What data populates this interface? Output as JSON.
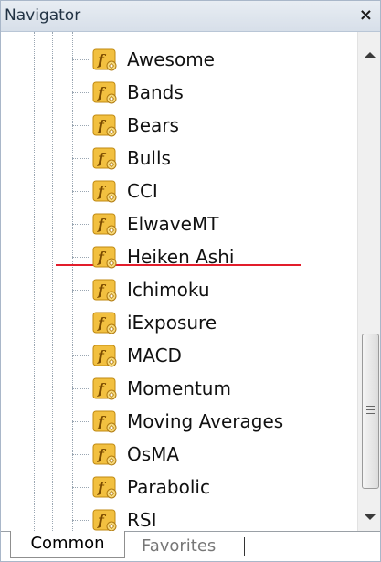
{
  "window": {
    "title": "Navigator",
    "close_label": "×"
  },
  "tree": {
    "icon": "indicator-f-icon",
    "items": [
      {
        "label": "Awesome"
      },
      {
        "label": "Bands"
      },
      {
        "label": "Bears"
      },
      {
        "label": "Bulls"
      },
      {
        "label": "CCI"
      },
      {
        "label": "ElwaveMT",
        "highlighted": true
      },
      {
        "label": "Heiken Ashi"
      },
      {
        "label": "Ichimoku"
      },
      {
        "label": "iExposure"
      },
      {
        "label": "MACD"
      },
      {
        "label": "Momentum"
      },
      {
        "label": "Moving Averages"
      },
      {
        "label": "OsMA"
      },
      {
        "label": "Parabolic"
      },
      {
        "label": "RSI"
      }
    ]
  },
  "tabs": [
    {
      "label": "Common",
      "active": true
    },
    {
      "label": "Favorites",
      "active": false
    }
  ],
  "colors": {
    "highlight_underline": "#e21d2b",
    "icon_fill": "#f2c040",
    "icon_border": "#c08a12"
  }
}
